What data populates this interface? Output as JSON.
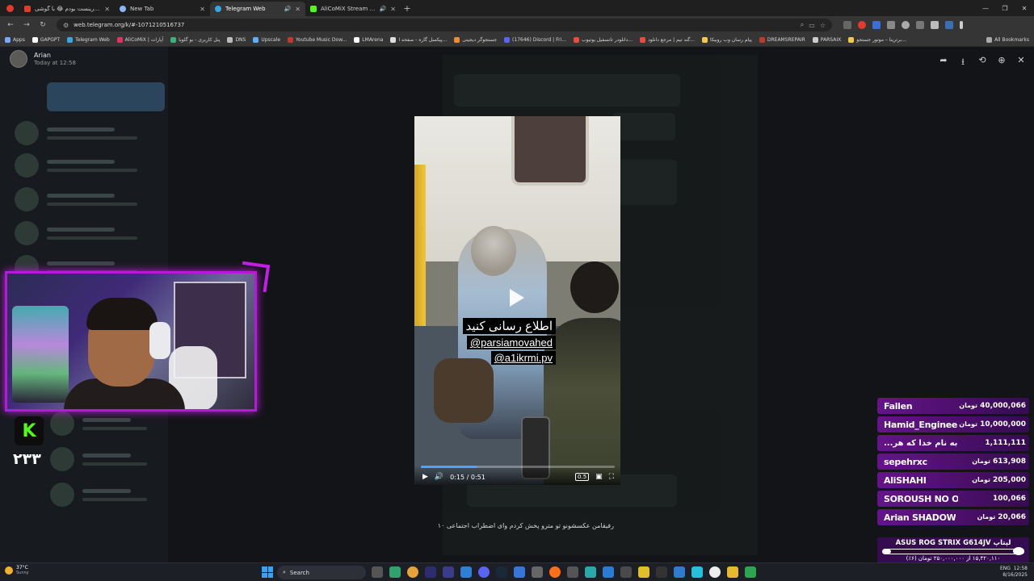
{
  "browser": {
    "tabs": [
      {
        "title": "الگ من تورینست بودم 😂 با گوشی",
        "favicon_color": "#e23b2e",
        "active": false
      },
      {
        "title": "New Tab",
        "favicon_color": "#8ab4f8",
        "active": false
      },
      {
        "title": "Telegram Web",
        "favicon_color": "#3aa6e0",
        "active": true
      },
      {
        "title": "AliCoMiX Stream - Watch Live ...",
        "favicon_color": "#53fc18",
        "active": false
      }
    ],
    "url": "web.telegram.org/k/#-1071210516737",
    "bookmarks": [
      {
        "label": "Apps",
        "color": "#7aa7ff"
      },
      {
        "label": "GAPGPT",
        "color": "#ffffff"
      },
      {
        "label": "Telegram Web",
        "color": "#3aa6e0"
      },
      {
        "label": "AliCoMiX | آپارات",
        "color": "#e5315d"
      },
      {
        "label": "پنل کاربری - بو گلوبا",
        "color": "#3ab07a"
      },
      {
        "label": "DNS",
        "color": "#bbbbbb"
      },
      {
        "label": "Upscale",
        "color": "#5ab1ff"
      },
      {
        "label": "Youtube Music Dow...",
        "color": "#c0392b"
      },
      {
        "label": "LMArena",
        "color": "#ffffff"
      },
      {
        "label": "پیکسل گاره - صفحه ا...",
        "color": "#dddddd"
      },
      {
        "label": "جستجوگر دیجیتی",
        "color": "#f28b30"
      },
      {
        "label": "(17646) Discord | Fri...",
        "color": "#5865f2"
      },
      {
        "label": "دانلودر تانسفیل یوتیوب...",
        "color": "#e74c3c"
      },
      {
        "label": "گند تیم | مرجع دانلود...",
        "color": "#e74c3c"
      },
      {
        "label": "پیام رسان وب روبیکا",
        "color": "#f2c94c"
      },
      {
        "label": "DREAMSREPAIR",
        "color": "#c0392b"
      },
      {
        "label": "PARSAIX",
        "color": "#cccccc"
      },
      {
        "label": "برترینا – موتور جستجو...",
        "color": "#f2c94c"
      },
      {
        "label": "All Bookmarks",
        "color": "#aaaaaa"
      }
    ]
  },
  "viewer": {
    "author": "Arian",
    "time": "Today at 12:58",
    "caption": "رفیقامن عکسشونو تو مترو پخش کردم وای اضطراب اجتماعی ۱۰",
    "tools": [
      "share-icon",
      "download-icon",
      "rotate-icon",
      "zoom-icon",
      "close-icon"
    ]
  },
  "video": {
    "overlay_line1": "اطلاع رسانی کنید",
    "overlay_line2": "@parsiamovahed",
    "overlay_line3": "@a1ikrmi.pv",
    "time": "0:15 / 0:51",
    "progress_fraction": 0.29,
    "speed": "0.5"
  },
  "stream": {
    "kick_logo": "K",
    "viewer_count": "۲۳۳",
    "donations": [
      {
        "name": "Fallen",
        "amount": "40,000,066",
        "currency": "تومان"
      },
      {
        "name": "Hamid_Engineer",
        "amount": "10,000,000",
        "currency": "تومان"
      },
      {
        "name": "به نام خدا که هر...",
        "amount": "1,111,111",
        "currency": ""
      },
      {
        "name": "sepehrxc",
        "amount": "613,908",
        "currency": "تومان"
      },
      {
        "name": "AliSHAHI",
        "amount": "205,000",
        "currency": "تومان"
      },
      {
        "name": "SOROUSH NO O...",
        "amount": "100,066",
        "currency": ""
      },
      {
        "name": "Arian SHADOW",
        "amount": "20,066",
        "currency": "تومان"
      }
    ],
    "goal_title": "لپتاپ ASUS ROG STRIX G614JV",
    "goal_text": "۱۵,۴۲۰,۱۱۰ از ۲۵۰,۰۰۰,۰۰۰ تومان (۶٪)",
    "goal_fraction": 0.06
  },
  "taskbar": {
    "weather_temp": "37°C",
    "weather_desc": "Sunny",
    "search_label": "Search",
    "clock_time": "12:58",
    "clock_date": "8/16/2025",
    "lang": "ENG"
  }
}
